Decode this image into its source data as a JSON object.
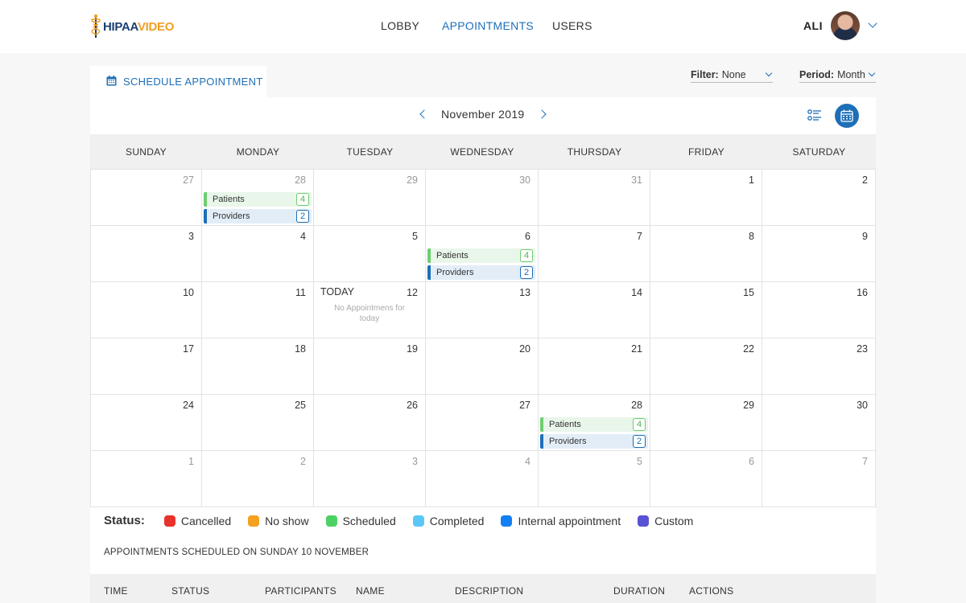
{
  "brand": {
    "logo_part1": "HIPAA",
    "logo_part2": "VIDEO"
  },
  "nav": {
    "items": [
      "LOBBY",
      "APPOINTMENTS",
      "USERS"
    ],
    "active": "APPOINTMENTS"
  },
  "user": {
    "name": "ALI"
  },
  "toolbar": {
    "schedule_label": "SCHEDULE APPOINTMENT",
    "filter_label": "Filter:",
    "filter_value": "None",
    "period_label": "Period:",
    "period_value": "Month"
  },
  "calendar": {
    "month_title": "November 2019",
    "weekdays": [
      "SUNDAY",
      "MONDAY",
      "TUESDAY",
      "WEDNESDAY",
      "THURSDAY",
      "FRIDAY",
      "SATURDAY"
    ],
    "today_label": "TODAY",
    "no_appointments": "No Appointmens for today",
    "patients_label": "Patients",
    "providers_label": "Providers",
    "weeks": [
      [
        {
          "d": "27",
          "o": true
        },
        {
          "d": "28",
          "o": true,
          "ev": {
            "p": "4",
            "v": "2"
          }
        },
        {
          "d": "29",
          "o": true
        },
        {
          "d": "30",
          "o": true
        },
        {
          "d": "31",
          "o": true
        },
        {
          "d": "1"
        },
        {
          "d": "2"
        }
      ],
      [
        {
          "d": "3"
        },
        {
          "d": "4"
        },
        {
          "d": "5"
        },
        {
          "d": "6",
          "ev": {
            "p": "4",
            "v": "2"
          }
        },
        {
          "d": "7"
        },
        {
          "d": "8"
        },
        {
          "d": "9"
        }
      ],
      [
        {
          "d": "10"
        },
        {
          "d": "11"
        },
        {
          "d": "12",
          "today": true
        },
        {
          "d": "13"
        },
        {
          "d": "14"
        },
        {
          "d": "15"
        },
        {
          "d": "16"
        }
      ],
      [
        {
          "d": "17"
        },
        {
          "d": "18"
        },
        {
          "d": "19"
        },
        {
          "d": "20"
        },
        {
          "d": "21"
        },
        {
          "d": "22"
        },
        {
          "d": "23"
        }
      ],
      [
        {
          "d": "24"
        },
        {
          "d": "25"
        },
        {
          "d": "26"
        },
        {
          "d": "27"
        },
        {
          "d": "28",
          "ev": {
            "p": "4",
            "v": "2"
          }
        },
        {
          "d": "29"
        },
        {
          "d": "30"
        }
      ],
      [
        {
          "d": "1",
          "o": true
        },
        {
          "d": "2",
          "o": true
        },
        {
          "d": "3",
          "o": true
        },
        {
          "d": "4",
          "o": true
        },
        {
          "d": "5",
          "o": true
        },
        {
          "d": "6",
          "o": true
        },
        {
          "d": "7",
          "o": true
        }
      ]
    ]
  },
  "status": {
    "title": "Status:",
    "items": [
      {
        "label": "Cancelled",
        "color": "#e8322c"
      },
      {
        "label": "No show",
        "color": "#f5a020"
      },
      {
        "label": "Scheduled",
        "color": "#4cd263"
      },
      {
        "label": "Completed",
        "color": "#5ac8f5"
      },
      {
        "label": "Internal appointment",
        "color": "#137ff5"
      },
      {
        "label": "Custom",
        "color": "#5a52d5"
      }
    ]
  },
  "schedule": {
    "title": "APPOINTMENTS SCHEDULED ON SUNDAY 10 NOVEMBER",
    "columns": [
      "TIME",
      "STATUS",
      "PARTICIPANTS",
      "NAME",
      "DESCRIPTION",
      "DURATION",
      "ACTIONS"
    ]
  }
}
